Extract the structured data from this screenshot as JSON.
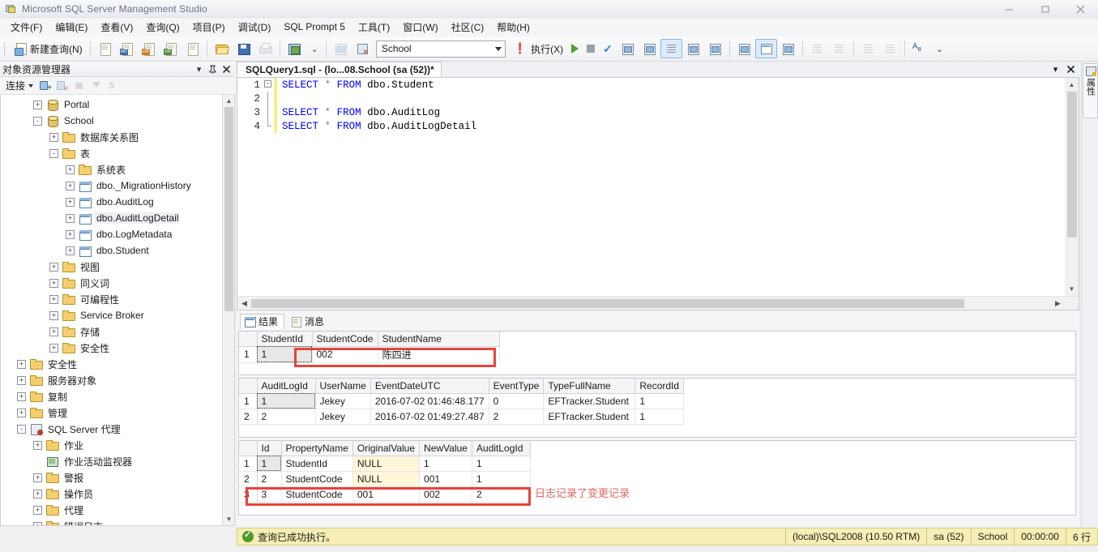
{
  "window": {
    "title": "Microsoft SQL Server Management Studio",
    "minimize_label": "—",
    "maximize_label": "❐",
    "close_label": "✕"
  },
  "menu": {
    "items": [
      {
        "label": "文件(F)",
        "name": "menu-file"
      },
      {
        "label": "编辑(E)",
        "name": "menu-edit"
      },
      {
        "label": "查看(V)",
        "name": "menu-view"
      },
      {
        "label": "查询(Q)",
        "name": "menu-query"
      },
      {
        "label": "项目(P)",
        "name": "menu-project"
      },
      {
        "label": "调试(D)",
        "name": "menu-debug"
      },
      {
        "label": "SQL Prompt 5",
        "name": "menu-sql-prompt"
      },
      {
        "label": "工具(T)",
        "name": "menu-tools"
      },
      {
        "label": "窗口(W)",
        "name": "menu-window"
      },
      {
        "label": "社区(C)",
        "name": "menu-community"
      },
      {
        "label": "帮助(H)",
        "name": "menu-help"
      }
    ]
  },
  "toolbar": {
    "new_query_label": "新建查询(N)",
    "database_value": "School",
    "execute_label": "执行(X)",
    "icons": {
      "new_query": "new-query-icon",
      "new_db_query": "new-database-engine-query-icon",
      "new_mdx_query": "new-analysis-services-mdx-query-icon",
      "new_dmx_query": "new-analysis-services-dmx-query-icon",
      "new_xmla_query": "new-analysis-services-xmla-query-icon",
      "new_sql_ce_query": "new-sql-server-compact-query-icon",
      "open": "open-file-icon",
      "save": "save-icon",
      "save_all": "save-all-icon",
      "print": "print-icon",
      "activity_monitor": "activity-monitor-icon",
      "debug": "debug-icon",
      "cancel_query": "cancel-executing-query-icon",
      "execute_bang": "execute-warning-icon",
      "execute_play": "execute-play-icon",
      "stop": "stop-icon",
      "parse": "parse-check-icon",
      "display_estimated_plan": "display-estimated-execution-plan-icon",
      "query_options": "query-options-icon",
      "results_to_text": "results-to-text-icon",
      "results_to_grid": "results-to-grid-icon",
      "results_to_file": "results-to-file-icon",
      "include_actual_plan": "include-actual-execution-plan-icon",
      "include_client_stats": "include-client-statistics-icon",
      "comment": "comment-selection-icon",
      "uncomment": "uncomment-selection-icon",
      "decrease_indent": "decrease-indent-icon",
      "increase_indent": "increase-indent-icon",
      "specify_values": "specify-values-for-template-parameters-icon",
      "overflow": "toolbar-overflow-icon"
    }
  },
  "object_explorer": {
    "title": "对象资源管理器",
    "dropdown_icon": "chevron-down-icon",
    "pin_icon": "pin-icon",
    "close_icon": "close-icon",
    "connect_label": "连接",
    "toolbar_icons": {
      "connect": "connect-object-explorer-icon",
      "disconnect": "disconnect-icon",
      "stop": "stop-icon",
      "filter": "filter-icon",
      "refresh": "refresh-script-icon"
    },
    "tree": [
      {
        "label": "Portal",
        "indent": 1,
        "expander": "+",
        "icon": "database-icon"
      },
      {
        "label": "School",
        "indent": 1,
        "expander": "-",
        "icon": "database-icon"
      },
      {
        "label": "数据库关系图",
        "indent": 2,
        "expander": "+",
        "icon": "folder-icon"
      },
      {
        "label": "表",
        "indent": 2,
        "expander": "-",
        "icon": "folder-icon"
      },
      {
        "label": "系统表",
        "indent": 3,
        "expander": "+",
        "icon": "folder-icon"
      },
      {
        "label": "dbo._MigrationHistory",
        "indent": 3,
        "expander": "+",
        "icon": "table-icon"
      },
      {
        "label": "dbo.AuditLog",
        "indent": 3,
        "expander": "+",
        "icon": "table-icon"
      },
      {
        "label": "dbo.AuditLogDetail",
        "indent": 3,
        "expander": "+",
        "icon": "table-icon",
        "highlight": true
      },
      {
        "label": "dbo.LogMetadata",
        "indent": 3,
        "expander": "+",
        "icon": "table-icon"
      },
      {
        "label": "dbo.Student",
        "indent": 3,
        "expander": "+",
        "icon": "table-icon"
      },
      {
        "label": "视图",
        "indent": 2,
        "expander": "+",
        "icon": "folder-icon"
      },
      {
        "label": "同义词",
        "indent": 2,
        "expander": "+",
        "icon": "folder-icon"
      },
      {
        "label": "可编程性",
        "indent": 2,
        "expander": "+",
        "icon": "folder-icon"
      },
      {
        "label": "Service Broker",
        "indent": 2,
        "expander": "+",
        "icon": "folder-icon"
      },
      {
        "label": "存储",
        "indent": 2,
        "expander": "+",
        "icon": "folder-icon"
      },
      {
        "label": "安全性",
        "indent": 2,
        "expander": "+",
        "icon": "folder-icon"
      },
      {
        "label": "安全性",
        "indent": 0,
        "expander": "+",
        "icon": "folder-icon"
      },
      {
        "label": "服务器对象",
        "indent": 0,
        "expander": "+",
        "icon": "folder-icon"
      },
      {
        "label": "复制",
        "indent": 0,
        "expander": "+",
        "icon": "folder-icon"
      },
      {
        "label": "管理",
        "indent": 0,
        "expander": "+",
        "icon": "folder-icon"
      },
      {
        "label": "SQL Server 代理",
        "indent": 0,
        "expander": "-",
        "icon": "sql-agent-icon"
      },
      {
        "label": "作业",
        "indent": 1,
        "expander": "+",
        "icon": "folder-icon"
      },
      {
        "label": "作业活动监视器",
        "indent": 1,
        "expander": "",
        "icon": "job-activity-monitor-icon"
      },
      {
        "label": "警报",
        "indent": 1,
        "expander": "+",
        "icon": "folder-icon"
      },
      {
        "label": "操作员",
        "indent": 1,
        "expander": "+",
        "icon": "folder-icon"
      },
      {
        "label": "代理",
        "indent": 1,
        "expander": "+",
        "icon": "folder-icon"
      },
      {
        "label": "错误日志",
        "indent": 1,
        "expander": "+",
        "icon": "folder-icon"
      }
    ]
  },
  "editor": {
    "tab_label": "SQLQuery1.sql - (lo...08.School (sa (52))*",
    "tab_dropdown_icon": "chevron-down-icon",
    "tab_close_icon": "close-icon",
    "lines": [
      {
        "num": "1",
        "text": "SELECT * FROM dbo.Student",
        "fold": "collapse",
        "modified": true
      },
      {
        "num": "2",
        "text": "",
        "fold": "line",
        "modified": true
      },
      {
        "num": "3",
        "text": "SELECT * FROM dbo.AuditLog",
        "fold": "line",
        "modified": true
      },
      {
        "num": "4",
        "text": "SELECT * FROM dbo.AuditLogDetail",
        "fold": "end",
        "modified": true
      }
    ]
  },
  "results": {
    "tabs": [
      {
        "label": "结果",
        "icon": "results-grid-icon",
        "active": true
      },
      {
        "label": "消息",
        "icon": "messages-icon",
        "active": false
      }
    ],
    "grid1": {
      "columns": [
        "StudentId",
        "StudentCode",
        "StudentName"
      ],
      "rows": [
        {
          "no": "1",
          "cells": [
            "1",
            "002",
            "陈四进"
          ]
        }
      ]
    },
    "grid2": {
      "columns": [
        "AuditLogId",
        "UserName",
        "EventDateUTC",
        "EventType",
        "TypeFullName",
        "RecordId"
      ],
      "rows": [
        {
          "no": "1",
          "cells": [
            "1",
            "Jekey",
            "2016-07-02 01:46:48.177",
            "0",
            "EFTracker.Student",
            "1"
          ]
        },
        {
          "no": "2",
          "cells": [
            "2",
            "Jekey",
            "2016-07-02 01:49:27.487",
            "2",
            "EFTracker.Student",
            "1"
          ]
        }
      ]
    },
    "grid3": {
      "columns": [
        "Id",
        "PropertyName",
        "OriginalValue",
        "NewValue",
        "AuditLogId"
      ],
      "rows": [
        {
          "no": "1",
          "cells": [
            "1",
            "StudentId",
            "NULL",
            "1",
            "1"
          ]
        },
        {
          "no": "2",
          "cells": [
            "2",
            "StudentCode",
            "NULL",
            "001",
            "1"
          ]
        },
        {
          "no": "3",
          "cells": [
            "3",
            "StudentCode",
            "001",
            "002",
            "2"
          ]
        }
      ]
    },
    "annotation": "日志记录了变更记录"
  },
  "status_bar": {
    "message": "查询已成功执行。",
    "server": "(local)\\SQL2008 (10.50 RTM)",
    "user": "sa (52)",
    "database": "School",
    "elapsed": "00:00:00",
    "rows": "6 行",
    "ok_icon": "success-check-icon"
  },
  "right_panel": {
    "tab_label": "属性",
    "icon": "properties-icon"
  },
  "colors": {
    "accent_red": "#e8443a",
    "annotation_red": "#e0645e",
    "status_bg": "#f6eeb4",
    "keyword_blue": "#0000ff",
    "null_bg": "#fdf6d8"
  }
}
